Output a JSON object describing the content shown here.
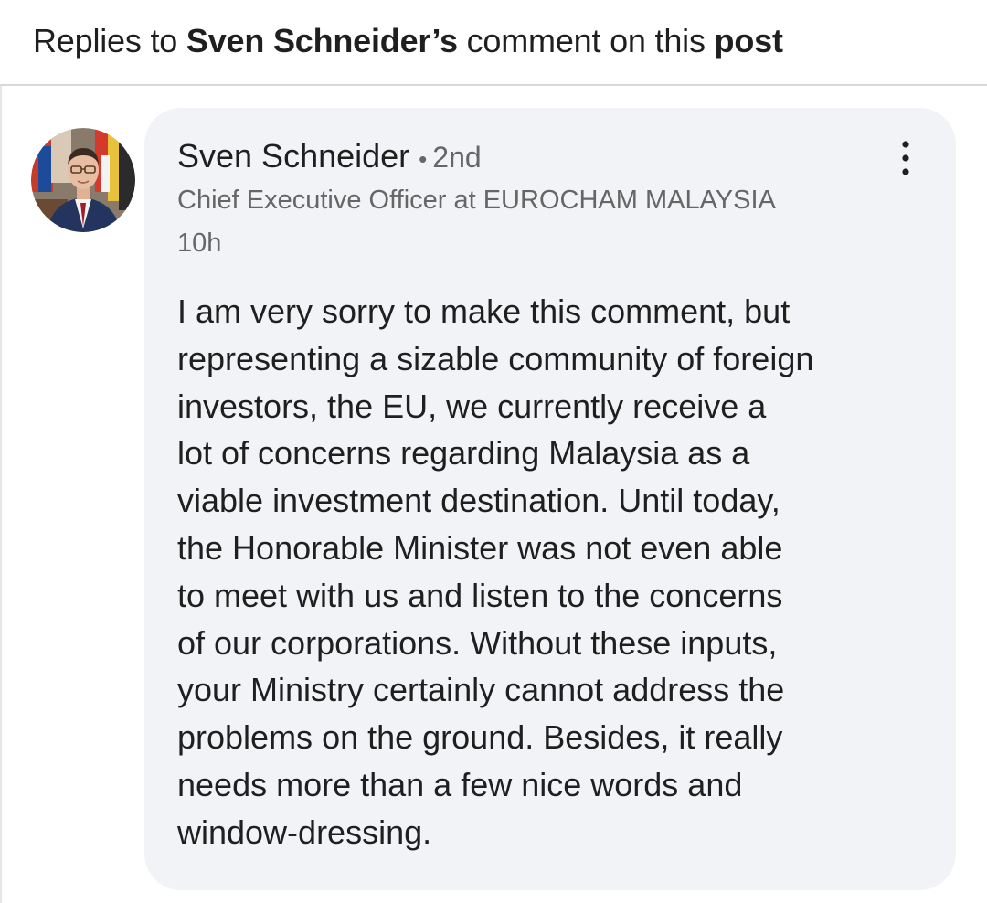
{
  "header": {
    "prefix": "Replies to ",
    "name": "Sven Schneider’s",
    "middle": " comment on this ",
    "link": "post"
  },
  "comment": {
    "author_name": "Sven Schneider",
    "separator": "•",
    "degree": "2nd",
    "headline": "Chief Executive Officer at EUROCHAM MALAYSIA",
    "timestamp": "10h",
    "more_icon": "more-vertical-icon",
    "body_lines": [
      "I am very sorry to make this comment, but",
      "representing a sizable community of foreign",
      "investors, the EU, we currently receive a",
      "lot of concerns regarding Malaysia as a",
      "viable investment destination. Until today,",
      "the Honorable Minister was not even able",
      "to meet with us and listen to the concerns",
      "of our corporations. Without these inputs,",
      "your Ministry certainly cannot address the",
      "problems on the ground. Besides, it really",
      "needs more than a few nice words and",
      "window-dressing."
    ]
  },
  "colors": {
    "bubble_bg": "#f1f3f6",
    "text_primary": "#1f1f1f",
    "text_secondary": "#666666",
    "divider": "#d9d9d9"
  }
}
